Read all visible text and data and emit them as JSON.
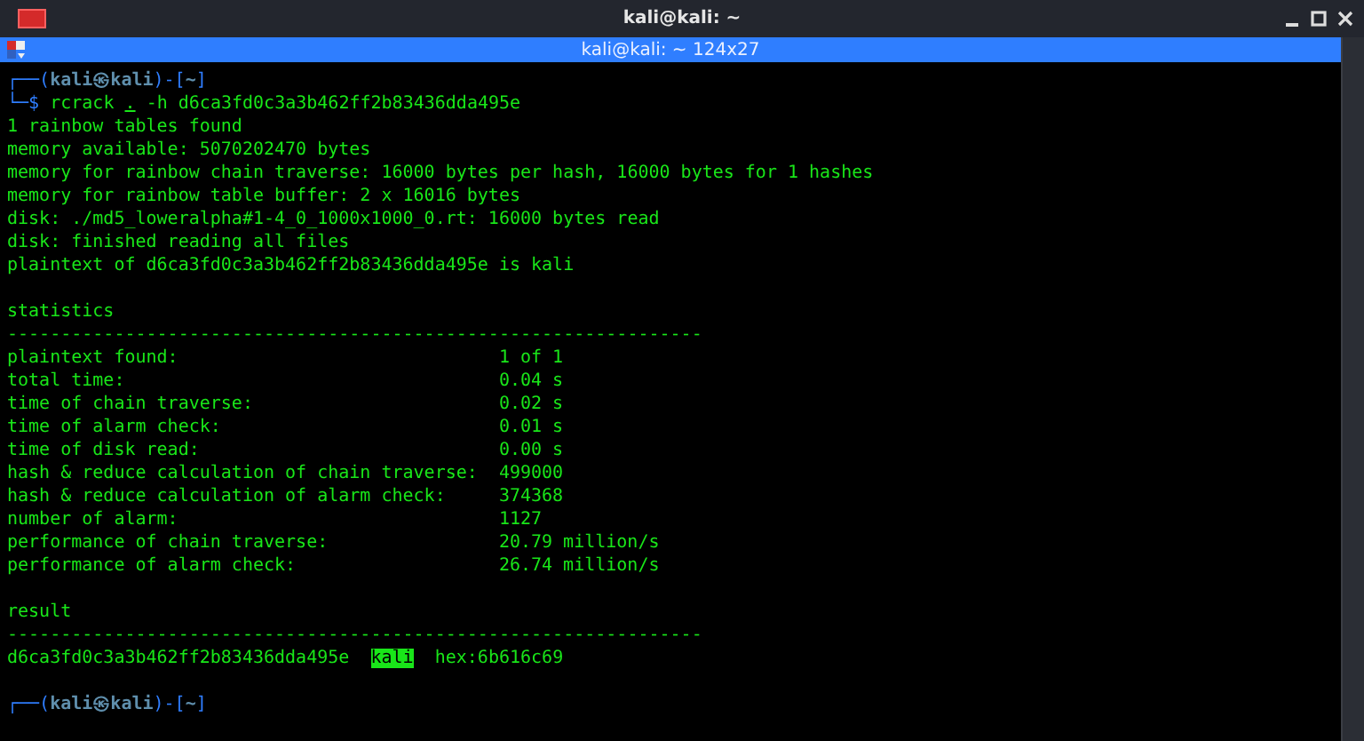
{
  "window": {
    "title": "kali@kali: ~"
  },
  "tab_title": "kali@kali: ~ 124x27",
  "prompt_top": {
    "corner": "┌──(",
    "user": "kali㉿kali",
    "mid": ")-[",
    "dir": "~",
    "end": "]"
  },
  "command": {
    "corner": "└─$",
    "program": "rcrack",
    "arg": ".",
    "flag": "-h",
    "hash": "d6ca3fd0c3a3b462ff2b83436dda495e"
  },
  "output": [
    "1 rainbow tables found",
    "memory available: 5070202470 bytes",
    "memory for rainbow chain traverse: 16000 bytes per hash, 16000 bytes for 1 hashes",
    "memory for rainbow table buffer: 2 x 16016 bytes",
    "disk: ./md5_loweralpha#1-4_0_1000x1000_0.rt: 16000 bytes read",
    "disk: finished reading all files",
    "plaintext of d6ca3fd0c3a3b462ff2b83436dda495e is kali"
  ],
  "statistics": {
    "heading": "statistics",
    "rule": "-----------------------------------------------------------------",
    "rows": [
      {
        "label": "plaintext found:",
        "value": "1 of 1"
      },
      {
        "label": "total time:",
        "value": "0.04 s"
      },
      {
        "label": "time of chain traverse:",
        "value": "0.02 s"
      },
      {
        "label": "time of alarm check:",
        "value": "0.01 s"
      },
      {
        "label": "time of disk read:",
        "value": "0.00 s"
      },
      {
        "label": "hash & reduce calculation of chain traverse:",
        "value": "499000"
      },
      {
        "label": "hash & reduce calculation of alarm check:",
        "value": "374368"
      },
      {
        "label": "number of alarm:",
        "value": "1127"
      },
      {
        "label": "performance of chain traverse:",
        "value": "20.79 million/s"
      },
      {
        "label": "performance of alarm check:",
        "value": "26.74 million/s"
      }
    ]
  },
  "result": {
    "heading": "result",
    "rule": "-----------------------------------------------------------------",
    "hash": "d6ca3fd0c3a3b462ff2b83436dda495e",
    "plaintext": "kali",
    "highlighted": true,
    "hex": "hex:6b616c69"
  },
  "prompt_bottom": {
    "corner": "┌──(",
    "user": "kali㉿kali",
    "mid": ")-[",
    "dir": "~",
    "end": "]"
  }
}
